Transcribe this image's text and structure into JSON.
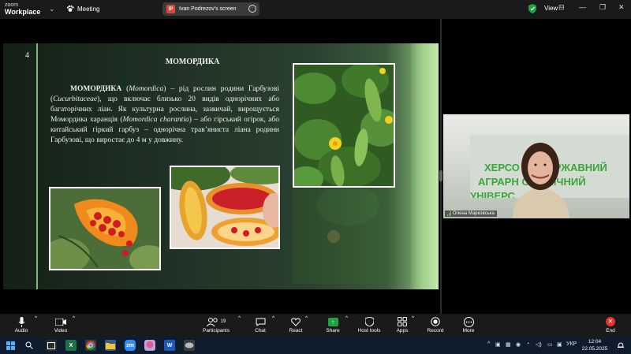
{
  "app": {
    "brand_line1": "zoom",
    "brand_line2": "Workplace",
    "meeting_label": "Meeting"
  },
  "share_pill": {
    "badge": "IP",
    "label": "Ivan Podrezov's screen"
  },
  "topbar": {
    "view_label": "View"
  },
  "slide": {
    "number": "4",
    "title": "МОМОРДИКА",
    "body_lead": "МОМОРДИКА",
    "body_p1": " (",
    "body_latin1": "Momordica",
    "body_p2": ") – рід рослин родини Гарбузові (",
    "body_latin2": "Cucurbitaceae",
    "body_p3": "), що включає близько 20 видів однорічних або багаторічних ліан. Як культурна рослина, зазвичай, вирощується Момордика харанція (",
    "body_latin3": "Momordica charantia",
    "body_p4": ") – або гірський огірок, або китайський гіркий гарбуз – однорічна трав’яниста ліана родини Гарбузові, що виростає до 4 м у довжину."
  },
  "video": {
    "participant_name": "Олена Марковська",
    "banner_line1": "ХЕРСО      ИЙ ДЕРЖАВНИЙ",
    "banner_line2": "АГРАРН      ОНОМІЧНИЙ",
    "banner_line3": "УНІВЕРС"
  },
  "toolbar": {
    "audio": "Audio",
    "video": "Video",
    "participants": "Participants",
    "participants_count": "19",
    "chat": "Chat",
    "react": "React",
    "share": "Share",
    "host_tools": "Host tools",
    "apps": "Apps",
    "record": "Record",
    "more": "More",
    "end": "End"
  },
  "taskbar": {
    "language": "УКР",
    "time": "12:04",
    "date": "22.05.2025"
  },
  "colors": {
    "share_green": "#1da542",
    "end_red": "#e5322d",
    "slide_accent": "#7fb77a"
  }
}
